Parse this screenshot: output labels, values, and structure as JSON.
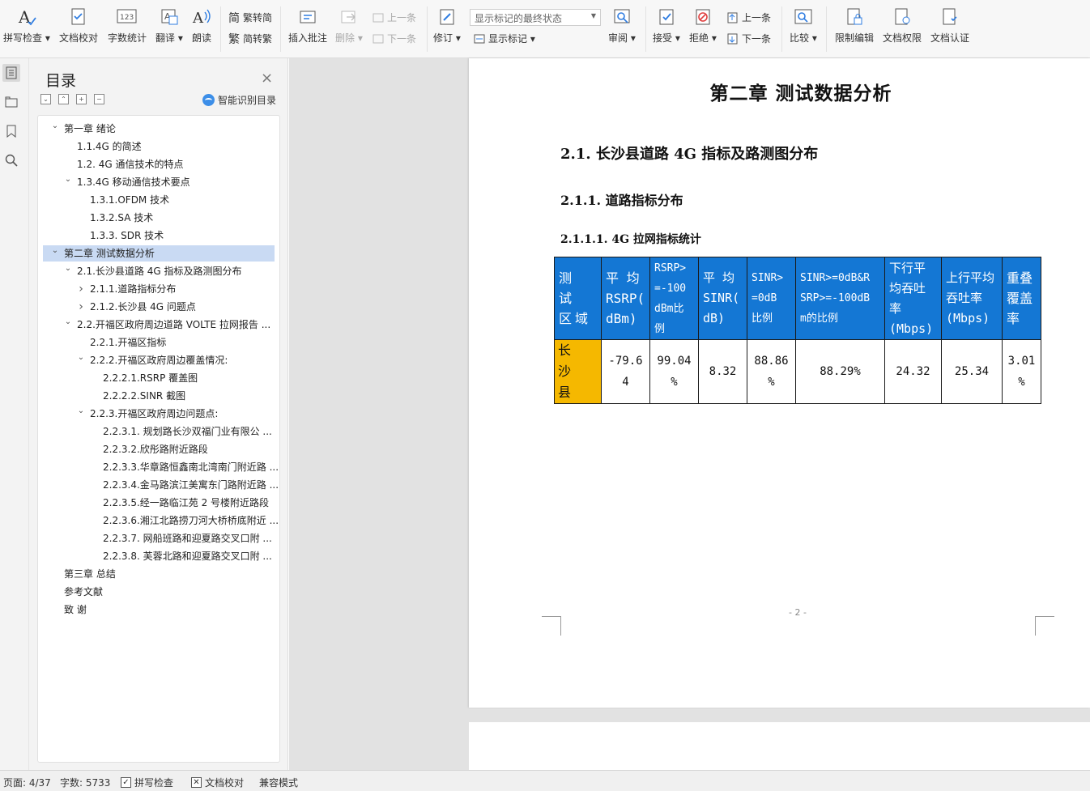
{
  "ribbon": {
    "spell_check": "拼写检查",
    "doc_proofread": "文档校对",
    "word_count": "字数统计",
    "translate": "翻译",
    "read_aloud": "朗读",
    "to_simplified": "繁转简",
    "to_traditional": "简转繁",
    "insert_comment": "插入批注",
    "delete": "删除",
    "prev_comment": "上一条",
    "next_comment": "下一条",
    "revise": "修订",
    "markup_dropdown": "显示标记的最终状态",
    "show_markup": "显示标记",
    "review": "审阅",
    "accept": "接受",
    "reject": "拒绝",
    "prev_change": "上一条",
    "next_change": "下一条",
    "compare": "比较",
    "restrict_edit": "限制编辑",
    "doc_permission": "文档权限",
    "doc_auth": "文档认证"
  },
  "nav": {
    "title": "目录",
    "smart_toc": "智能识别目录",
    "items": [
      {
        "label": "第一章  绪论",
        "level": 0,
        "chevron": "v"
      },
      {
        "label": "1.1.4G 的简述",
        "level": 1,
        "chevron": ""
      },
      {
        "label": "1.2.  4G 通信技术的特点",
        "level": 1,
        "chevron": ""
      },
      {
        "label": "1.3.4G 移动通信技术要点",
        "level": 1,
        "chevron": "v"
      },
      {
        "label": "1.3.1.OFDM 技术",
        "level": 2,
        "chevron": ""
      },
      {
        "label": "1.3.2.SA 技术",
        "level": 2,
        "chevron": ""
      },
      {
        "label": "1.3.3.  SDR 技术",
        "level": 2,
        "chevron": ""
      },
      {
        "label": "第二章  测试数据分析",
        "level": 0,
        "chevron": "v"
      },
      {
        "label": "2.1.长沙县道路 4G 指标及路测图分布",
        "level": 1,
        "chevron": "v"
      },
      {
        "label": "2.1.1.道路指标分布",
        "level": 2,
        "chevron": ">"
      },
      {
        "label": "2.1.2.长沙县 4G 问题点",
        "level": 2,
        "chevron": ">"
      },
      {
        "label": "2.2.开福区政府周边道路 VOLTE 拉网报告 ...",
        "level": 1,
        "chevron": "v"
      },
      {
        "label": "2.2.1.开福区指标",
        "level": 2,
        "chevron": ""
      },
      {
        "label": "2.2.2.开福区政府周边覆盖情况:",
        "level": 2,
        "chevron": "v"
      },
      {
        "label": "2.2.2.1.RSRP 覆盖图",
        "level": 3,
        "chevron": ""
      },
      {
        "label": "2.2.2.2.SINR 截图",
        "level": 3,
        "chevron": ""
      },
      {
        "label": "2.2.3.开福区政府周边问题点:",
        "level": 2,
        "chevron": "v"
      },
      {
        "label": "2.2.3.1.  规划路长沙双福门业有限公 ...",
        "level": 3,
        "chevron": ""
      },
      {
        "label": "2.2.3.2.欣彤路附近路段",
        "level": 3,
        "chevron": ""
      },
      {
        "label": "2.2.3.3.华章路恒鑫南北湾南门附近路 ...",
        "level": 3,
        "chevron": ""
      },
      {
        "label": "2.2.3.4.金马路滨江美寓东门路附近路 ...",
        "level": 3,
        "chevron": ""
      },
      {
        "label": "2.2.3.5.经一路临江苑 2 号楼附近路段",
        "level": 3,
        "chevron": ""
      },
      {
        "label": "2.2.3.6.湘江北路捞刀河大桥桥底附近 ...",
        "level": 3,
        "chevron": ""
      },
      {
        "label": "2.2.3.7.  网船班路和迎夏路交叉口附 ...",
        "level": 3,
        "chevron": ""
      },
      {
        "label": "2.2.3.8.  芙蓉北路和迎夏路交叉口附 ...",
        "level": 3,
        "chevron": ""
      },
      {
        "label": "第三章  总结",
        "level": 0,
        "chevron": ""
      },
      {
        "label": "参考文献",
        "level": 0,
        "chevron": ""
      },
      {
        "label": "致    谢",
        "level": 0,
        "chevron": ""
      }
    ]
  },
  "doc": {
    "chapter_title": "第二章  测试数据分析",
    "section": "2.1.   长沙县道路 4G 指标及路测图分布",
    "subsection": "2.1.1. 道路指标分布",
    "subsubsection": "2.1.1.1.   4G 拉网指标统计",
    "table": {
      "headers": [
        "测 试 区域",
        "平 均 RSRP( dBm)",
        "RSRP> =-100 dBm比例",
        "平 均 SINR( dB)",
        "SINR> =0dB 比例",
        "SINR>=0dB&R SRP>=-100dB m的比例",
        "下行平均吞吐率 (Mbps)",
        "上行平均吞吐率 (Mbps)",
        "重叠覆盖率"
      ],
      "row": [
        "长 沙 县",
        "-79.6 4",
        "99.04 %",
        "8.32",
        "88.86 %",
        "88.29%",
        "24.32",
        "25.34",
        "3.01 %"
      ]
    },
    "page_number": "- 2 -"
  },
  "status": {
    "page": "页面: 4/37",
    "words": "字数: 5733",
    "spell_check": "拼写检查",
    "doc_proofread": "文档校对",
    "compat_mode": "兼容模式"
  },
  "colors": {
    "table_header": "#1477d4",
    "area_cell": "#f5b800",
    "selection": "#c9daf3"
  }
}
